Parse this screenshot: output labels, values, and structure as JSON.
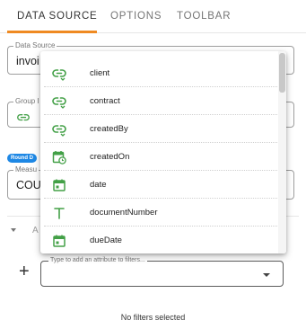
{
  "tabs": [
    {
      "label": "DATA SOURCE",
      "active": true
    },
    {
      "label": "OPTIONS",
      "active": false
    },
    {
      "label": "TOOLBAR",
      "active": false
    }
  ],
  "fields": {
    "data_source": {
      "legend": "Data Source",
      "value": "invoi"
    },
    "group": {
      "legend": "Group I"
    },
    "measure": {
      "legend": "Measu",
      "value": "COUN"
    },
    "round_badge": "Round D"
  },
  "section": {
    "letter": "A"
  },
  "filter": {
    "add_symbol": "+",
    "placeholder": "Type to add an attribute to filters..."
  },
  "no_filters_text": "No filters selected",
  "dropdown": {
    "options": [
      {
        "label": "client",
        "icon": "link-icon"
      },
      {
        "label": "contract",
        "icon": "link-icon"
      },
      {
        "label": "createdBy",
        "icon": "link-icon"
      },
      {
        "label": "createdOn",
        "icon": "calendar-clock-icon"
      },
      {
        "label": "date",
        "icon": "calendar-icon"
      },
      {
        "label": "documentNumber",
        "icon": "text-icon"
      },
      {
        "label": "dueDate",
        "icon": "calendar-icon"
      }
    ]
  },
  "colors": {
    "accent": "#ef8a22",
    "icon_green": "#43a047",
    "badge_blue": "#1e88e5"
  }
}
